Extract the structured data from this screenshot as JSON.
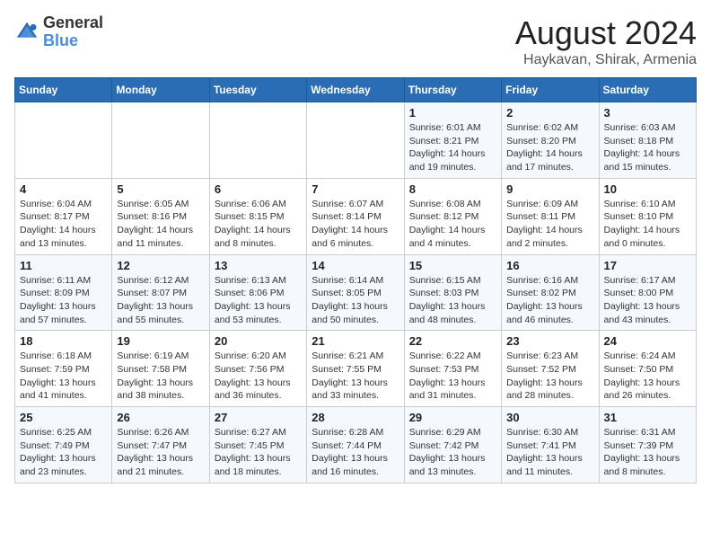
{
  "logo": {
    "line1": "General",
    "line2": "Blue"
  },
  "title": "August 2024",
  "subtitle": "Haykavan, Shirak, Armenia",
  "days_of_week": [
    "Sunday",
    "Monday",
    "Tuesday",
    "Wednesday",
    "Thursday",
    "Friday",
    "Saturday"
  ],
  "weeks": [
    [
      {
        "day": "",
        "info": ""
      },
      {
        "day": "",
        "info": ""
      },
      {
        "day": "",
        "info": ""
      },
      {
        "day": "",
        "info": ""
      },
      {
        "day": "1",
        "info": "Sunrise: 6:01 AM\nSunset: 8:21 PM\nDaylight: 14 hours\nand 19 minutes."
      },
      {
        "day": "2",
        "info": "Sunrise: 6:02 AM\nSunset: 8:20 PM\nDaylight: 14 hours\nand 17 minutes."
      },
      {
        "day": "3",
        "info": "Sunrise: 6:03 AM\nSunset: 8:18 PM\nDaylight: 14 hours\nand 15 minutes."
      }
    ],
    [
      {
        "day": "4",
        "info": "Sunrise: 6:04 AM\nSunset: 8:17 PM\nDaylight: 14 hours\nand 13 minutes."
      },
      {
        "day": "5",
        "info": "Sunrise: 6:05 AM\nSunset: 8:16 PM\nDaylight: 14 hours\nand 11 minutes."
      },
      {
        "day": "6",
        "info": "Sunrise: 6:06 AM\nSunset: 8:15 PM\nDaylight: 14 hours\nand 8 minutes."
      },
      {
        "day": "7",
        "info": "Sunrise: 6:07 AM\nSunset: 8:14 PM\nDaylight: 14 hours\nand 6 minutes."
      },
      {
        "day": "8",
        "info": "Sunrise: 6:08 AM\nSunset: 8:12 PM\nDaylight: 14 hours\nand 4 minutes."
      },
      {
        "day": "9",
        "info": "Sunrise: 6:09 AM\nSunset: 8:11 PM\nDaylight: 14 hours\nand 2 minutes."
      },
      {
        "day": "10",
        "info": "Sunrise: 6:10 AM\nSunset: 8:10 PM\nDaylight: 14 hours\nand 0 minutes."
      }
    ],
    [
      {
        "day": "11",
        "info": "Sunrise: 6:11 AM\nSunset: 8:09 PM\nDaylight: 13 hours\nand 57 minutes."
      },
      {
        "day": "12",
        "info": "Sunrise: 6:12 AM\nSunset: 8:07 PM\nDaylight: 13 hours\nand 55 minutes."
      },
      {
        "day": "13",
        "info": "Sunrise: 6:13 AM\nSunset: 8:06 PM\nDaylight: 13 hours\nand 53 minutes."
      },
      {
        "day": "14",
        "info": "Sunrise: 6:14 AM\nSunset: 8:05 PM\nDaylight: 13 hours\nand 50 minutes."
      },
      {
        "day": "15",
        "info": "Sunrise: 6:15 AM\nSunset: 8:03 PM\nDaylight: 13 hours\nand 48 minutes."
      },
      {
        "day": "16",
        "info": "Sunrise: 6:16 AM\nSunset: 8:02 PM\nDaylight: 13 hours\nand 46 minutes."
      },
      {
        "day": "17",
        "info": "Sunrise: 6:17 AM\nSunset: 8:00 PM\nDaylight: 13 hours\nand 43 minutes."
      }
    ],
    [
      {
        "day": "18",
        "info": "Sunrise: 6:18 AM\nSunset: 7:59 PM\nDaylight: 13 hours\nand 41 minutes."
      },
      {
        "day": "19",
        "info": "Sunrise: 6:19 AM\nSunset: 7:58 PM\nDaylight: 13 hours\nand 38 minutes."
      },
      {
        "day": "20",
        "info": "Sunrise: 6:20 AM\nSunset: 7:56 PM\nDaylight: 13 hours\nand 36 minutes."
      },
      {
        "day": "21",
        "info": "Sunrise: 6:21 AM\nSunset: 7:55 PM\nDaylight: 13 hours\nand 33 minutes."
      },
      {
        "day": "22",
        "info": "Sunrise: 6:22 AM\nSunset: 7:53 PM\nDaylight: 13 hours\nand 31 minutes."
      },
      {
        "day": "23",
        "info": "Sunrise: 6:23 AM\nSunset: 7:52 PM\nDaylight: 13 hours\nand 28 minutes."
      },
      {
        "day": "24",
        "info": "Sunrise: 6:24 AM\nSunset: 7:50 PM\nDaylight: 13 hours\nand 26 minutes."
      }
    ],
    [
      {
        "day": "25",
        "info": "Sunrise: 6:25 AM\nSunset: 7:49 PM\nDaylight: 13 hours\nand 23 minutes."
      },
      {
        "day": "26",
        "info": "Sunrise: 6:26 AM\nSunset: 7:47 PM\nDaylight: 13 hours\nand 21 minutes."
      },
      {
        "day": "27",
        "info": "Sunrise: 6:27 AM\nSunset: 7:45 PM\nDaylight: 13 hours\nand 18 minutes."
      },
      {
        "day": "28",
        "info": "Sunrise: 6:28 AM\nSunset: 7:44 PM\nDaylight: 13 hours\nand 16 minutes."
      },
      {
        "day": "29",
        "info": "Sunrise: 6:29 AM\nSunset: 7:42 PM\nDaylight: 13 hours\nand 13 minutes."
      },
      {
        "day": "30",
        "info": "Sunrise: 6:30 AM\nSunset: 7:41 PM\nDaylight: 13 hours\nand 11 minutes."
      },
      {
        "day": "31",
        "info": "Sunrise: 6:31 AM\nSunset: 7:39 PM\nDaylight: 13 hours\nand 8 minutes."
      }
    ]
  ]
}
